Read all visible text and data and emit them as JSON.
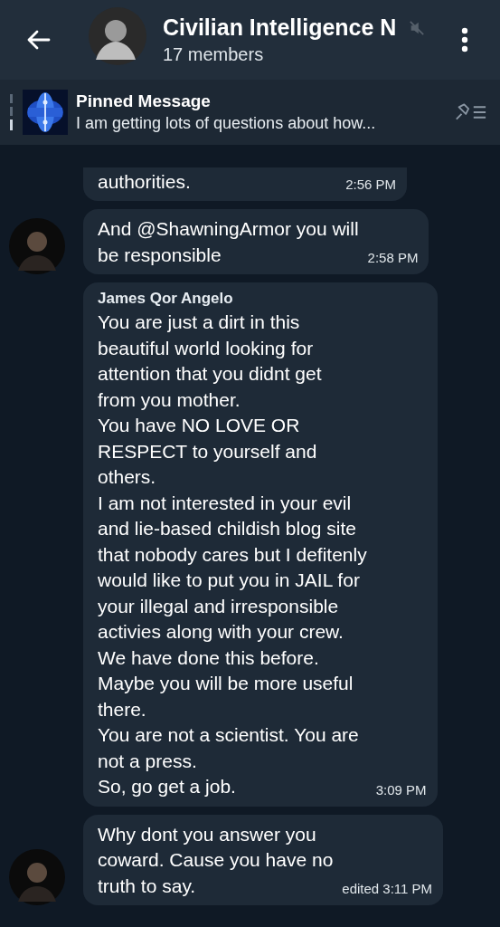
{
  "header": {
    "title": "Civilian Intelligence N",
    "subtitle": "17 members",
    "muted": true
  },
  "pinned": {
    "label": "Pinned Message",
    "text": "I am getting lots of questions about how..."
  },
  "messages": [
    {
      "text": "authorities.",
      "time": "2:56 PM",
      "avatar": false,
      "cut": true
    },
    {
      "text": "And @ShawningArmor you will\nbe responsible",
      "time": "2:58 PM",
      "avatar": true,
      "cut": false
    },
    {
      "sender": "James Qor Angelo",
      "text": "You are just a dirt in this\nbeautiful world looking for\nattention that you didnt get\nfrom you mother.\nYou have NO LOVE OR\nRESPECT to yourself and\nothers.\nI am not interested in your evil\nand lie-based childish blog site\nthat nobody cares but I defitenly\nwould like to put you in JAIL for\nyour illegal and irresponsible\nactivies along with your crew.\nWe have done this before.\nMaybe you will be more useful\nthere.\nYou are not a scientist. You are\nnot a press.\nSo, go get a job.",
      "time": "3:09 PM",
      "avatar": false,
      "cut": false
    },
    {
      "text": "Why dont you answer you\ncoward. Cause you have no\ntruth to say.",
      "time": "edited 3:11 PM",
      "avatar": true,
      "cut": false
    }
  ]
}
